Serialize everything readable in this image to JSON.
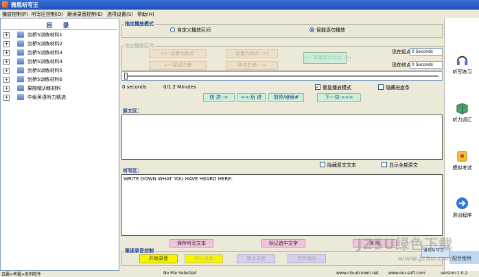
{
  "window": {
    "title": "雅思听写王"
  },
  "menu": [
    "播放控制(P)",
    "听写区控制(O)",
    "跟读录音控制(E)",
    "选项设置(S)",
    "帮助(H)"
  ],
  "sidebar": {
    "title": "目 录",
    "items": [
      "剑桥5训练材料1",
      "剑桥5训练材料2",
      "剑桥5训练材料3",
      "剑桥5训练材料4",
      "剑桥5训练材料5",
      "剑桥5训练材料6",
      "果酸精训练材料",
      "中级英语听力精选"
    ]
  },
  "play_mode": {
    "title": "指定播放模式",
    "option_custom": "自定义播放区间",
    "option_smart": "智能逐句播放",
    "selected": "smart"
  },
  "range": {
    "title": "指定播放区间",
    "set_start": "|<--设置为起点",
    "set_end": "设置为终点-->|",
    "reset": "|<--重置起点终点-->|",
    "start_left": "<---起点左移",
    "end_right": "终点右移--->",
    "current_start_label": "现在起点",
    "current_start_value": "0 Seconds",
    "current_end_label": "现在终点",
    "current_end_value": "0 Seconds"
  },
  "progress": {
    "position": "0 seconds",
    "total": "0/1.2 Minutes",
    "repeat_label": "重复播放模式",
    "repeat_checked": true,
    "hide_label": "隐藏进度条",
    "hide_checked": false
  },
  "controls": {
    "forward": "快 进-->",
    "back": "<<-后 退",
    "pause": "暂停/继续#",
    "next": "下一句->>>"
  },
  "original": {
    "title": "原文区：",
    "hide_label": "隐藏原文文本",
    "show_all_label": "显示全部原文"
  },
  "dictation": {
    "title": "听写区：",
    "placeholder": "WRITE DOWN WHAT YOU HAVE HEARD HERE:",
    "save": "保存听写文本",
    "mark": "标记选中文字",
    "clear": "清 除"
  },
  "recording": {
    "title": "跟读录音控制",
    "start": "开始录音",
    "stop": "停止录音",
    "play": "播放录音",
    "pause": "暂停播放"
  },
  "right_panel": [
    {
      "label": "听写练习",
      "icon": "headphones-icon"
    },
    {
      "label": "听力词汇",
      "icon": "book-icon"
    },
    {
      "label": "模拟考试",
      "icon": "exam-icon"
    },
    {
      "label": "退出程序",
      "icon": "exit-arrow-icon"
    }
  ],
  "status": {
    "crumb": "云霸<考霸>系列软件",
    "file": "No File Selected",
    "site1": "www.cloudcrown.net",
    "site2": "www.our-soft.com",
    "version": "version:1.0.2"
  },
  "watermark": {
    "line1": "雅思听写王",
    "line2": "配合使用",
    "big": "JZ5U绿色下载",
    "small": "www.jz5u.com"
  }
}
